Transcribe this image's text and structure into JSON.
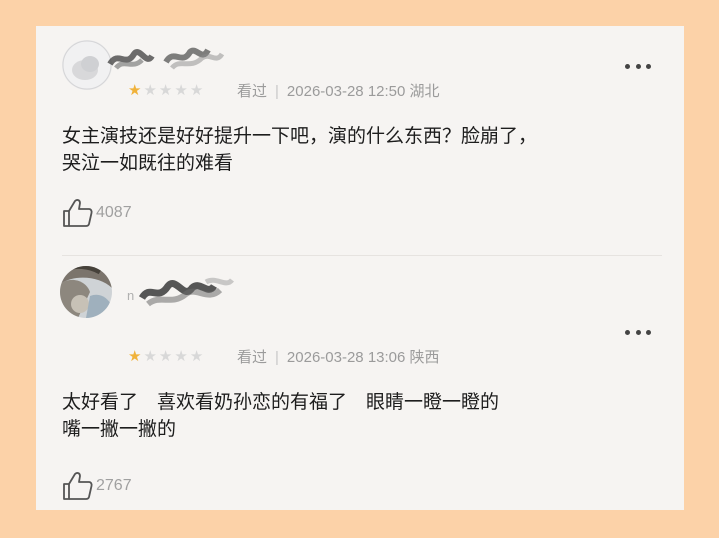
{
  "reviews": [
    {
      "user": {
        "name_visible": ""
      },
      "rating": 1,
      "status": "看过",
      "datetime": "2026-03-28 12:50",
      "location": "湖北",
      "content_line1": "女主演技还是好好提升一下吧，演的什么东西？脸崩了，",
      "content_line2": "哭泣一如既往的难看",
      "likes": "4087"
    },
    {
      "user": {
        "name_visible": "n"
      },
      "rating": 1,
      "status": "看过",
      "datetime": "2026-03-28 13:06",
      "location": "陕西",
      "content_line1": "太好看了　喜欢看奶孙恋的有福了　眼睛一瞪一瞪的",
      "content_line2": "嘴一撇一撇的",
      "likes": "2767"
    }
  ],
  "icons": {
    "more": "more-dots-icon",
    "like": "thumbs-up-icon",
    "star": "star-icon"
  },
  "colors": {
    "background": "#fcd2a8",
    "card": "#f6f4f2",
    "star_on": "#f0b23a",
    "star_off": "#d8d8d8",
    "meta_text": "#9b9b9b"
  }
}
